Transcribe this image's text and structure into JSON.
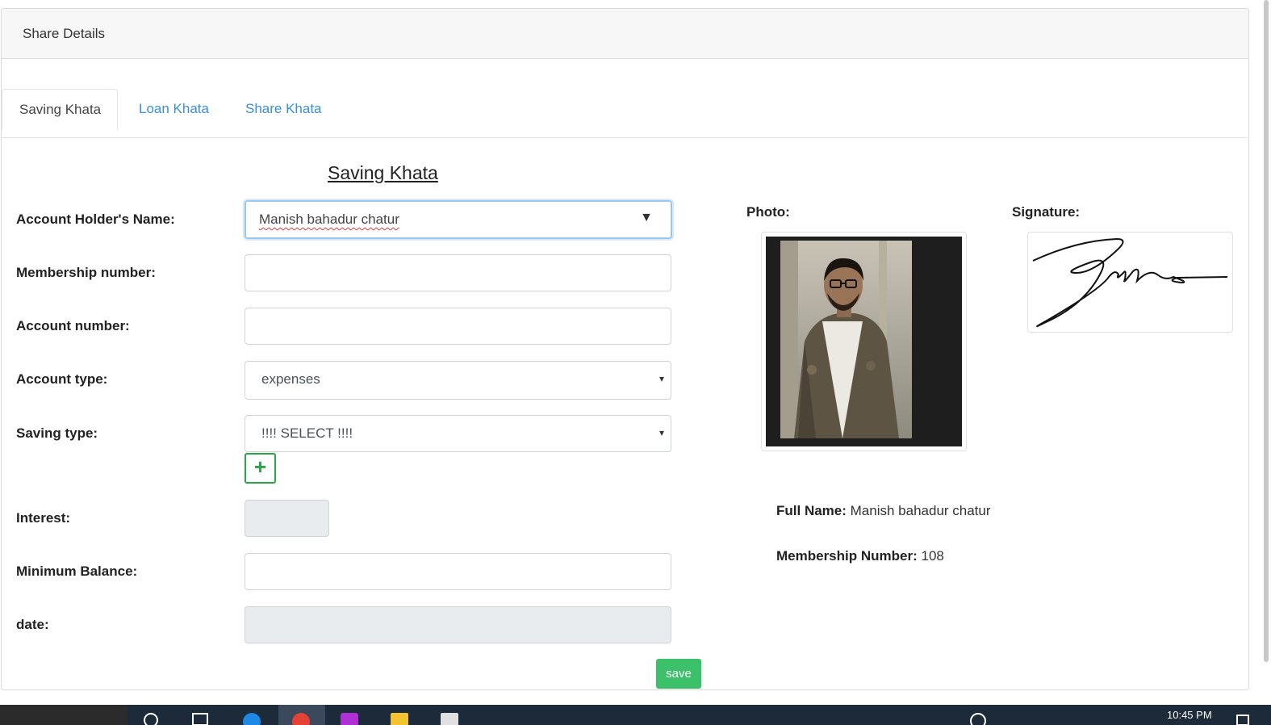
{
  "header": {
    "title": "Share Details"
  },
  "tabs": [
    {
      "label": "Saving Khata",
      "active": true
    },
    {
      "label": "Loan Khata",
      "active": false
    },
    {
      "label": "Share Khata",
      "active": false
    }
  ],
  "form": {
    "title": "Saving Khata",
    "account_holder": {
      "label": "Account Holder's Name:",
      "value": "Manish bahadur chatur"
    },
    "membership_number": {
      "label": "Membership number:",
      "value": ""
    },
    "account_number": {
      "label": "Account number:",
      "value": ""
    },
    "account_type": {
      "label": "Account type:",
      "value": "expenses"
    },
    "saving_type": {
      "label": "Saving type:",
      "value": "!!!! SELECT !!!!"
    },
    "add_button": "+",
    "interest": {
      "label": "Interest:",
      "value": ""
    },
    "minimum_balance": {
      "label": "Minimum Balance:",
      "value": ""
    },
    "date": {
      "label": "date:",
      "value": ""
    },
    "save_label": "save"
  },
  "side": {
    "photo_label": "Photo:",
    "signature_label": "Signature:",
    "full_name_label": "Full Name:",
    "full_name": "Manish bahadur chatur",
    "membership_label": "Membership Number:",
    "membership_number": "108"
  },
  "taskbar": {
    "clock": "10:45 PM"
  },
  "colors": {
    "accent": "#3a8fd9",
    "save": "#3cc06a",
    "add": "#28a745"
  }
}
